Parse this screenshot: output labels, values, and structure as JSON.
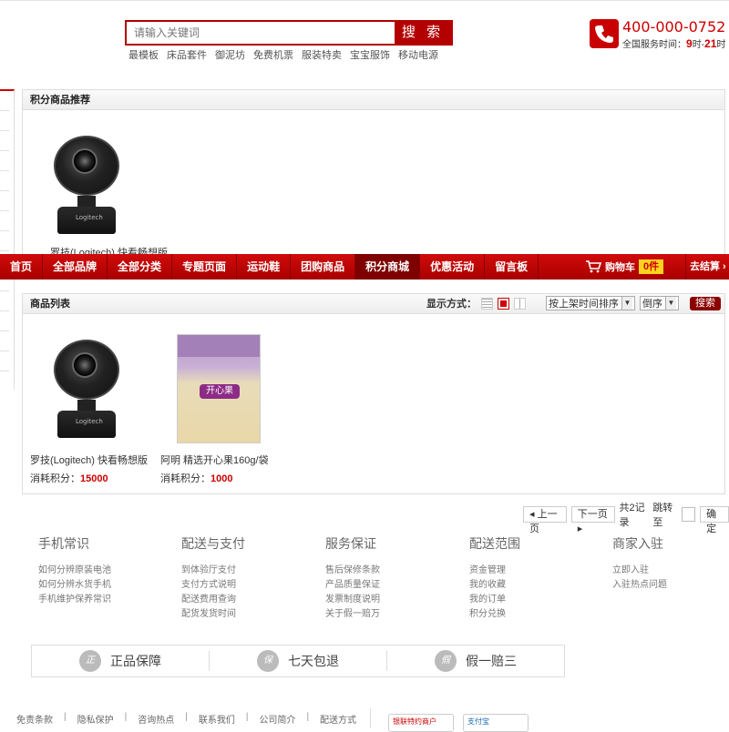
{
  "search": {
    "placeholder": "请输入关键词",
    "button": "搜 索"
  },
  "hotwords": [
    "最模板",
    "床品套件",
    "御泥坊",
    "免费机票",
    "服装特卖",
    "宝宝服饰",
    "移动电源"
  ],
  "phone": {
    "number": "400-000-0752",
    "hours_prefix": "全国服务时间：",
    "hours_start": "9",
    "hours_mid": "时-",
    "hours_end": "21",
    "hours_suffix": "时"
  },
  "recommend": {
    "title": "积分商品推荐",
    "product": {
      "name": "罗技(Logitech) 快看畅想版"
    }
  },
  "nav": {
    "items": [
      "首页",
      "全部品牌",
      "全部分类",
      "专题页面",
      "运动鞋",
      "团购商品",
      "积分商城",
      "优惠活动",
      "留言板"
    ],
    "active_index": 6,
    "cart_label": "购物车",
    "cart_count": "0件",
    "checkout": "去结算 ›"
  },
  "list": {
    "title": "商品列表",
    "display_label": "显示方式：",
    "sort_select": "按上架时间排序",
    "order_select": "倒序",
    "search_button": "搜索",
    "points_label": "消耗积分：",
    "products": [
      {
        "name": "罗技(Logitech) 快看畅想版",
        "points": "15000"
      },
      {
        "name": "阿明 精选开心果160g/袋",
        "points": "1000"
      }
    ],
    "nut_package_label": "开心果"
  },
  "pager": {
    "prev": "◂ 上一页",
    "next": "下一页 ▸",
    "summary": "共2记录",
    "goto": "跳转至",
    "confirm": "确定"
  },
  "help": [
    {
      "title": "手机常识",
      "links": [
        "如何分辨原装电池",
        "如何分辨水货手机",
        "手机维护保养常识"
      ]
    },
    {
      "title": "配送与支付",
      "links": [
        "到体验厅支付",
        "支付方式说明",
        "配送费用查询",
        "配货发货时间"
      ]
    },
    {
      "title": "服务保证",
      "links": [
        "售后保修条款",
        "产品质量保证",
        "发票制度说明",
        "关于假一赔万"
      ]
    },
    {
      "title": "配送范围",
      "links": [
        "资金管理",
        "我的收藏",
        "我的订单",
        "积分兑换"
      ]
    },
    {
      "title": "商家入驻",
      "links": [
        "立即入驻",
        "入驻热点问题"
      ]
    }
  ],
  "guarantees": [
    {
      "icon": "正",
      "label": "正品保障"
    },
    {
      "icon": "保",
      "label": "七天包退"
    },
    {
      "icon": "假",
      "label": "假一赔三"
    }
  ],
  "bottom_links": [
    "免责条款",
    "隐私保护",
    "咨询热点",
    "联系我们",
    "公司简介",
    "配送方式"
  ],
  "pay_logos": [
    "银联特约商户",
    "支付宝"
  ],
  "colors": {
    "brand_red": "#c00000",
    "nav_active": "#7e0000",
    "cart_badge": "#ffd21f"
  }
}
